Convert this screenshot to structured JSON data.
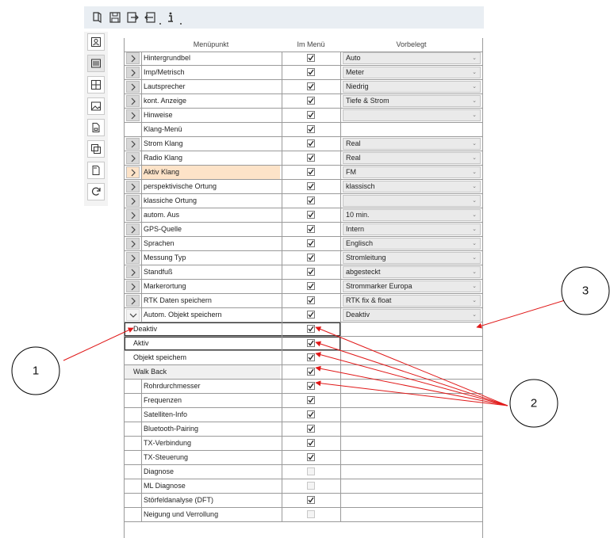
{
  "toolbar": {
    "buttons": [
      {
        "id": "open",
        "icon": "open-book-icon"
      },
      {
        "id": "save",
        "icon": "save-icon"
      },
      {
        "id": "export",
        "icon": "export-icon"
      },
      {
        "id": "import",
        "icon": "import-icon"
      },
      {
        "id": "info",
        "icon": "info-icon"
      }
    ]
  },
  "sidebar": {
    "buttons": [
      {
        "id": "person",
        "icon": "person-card-icon"
      },
      {
        "id": "list",
        "icon": "list-view-icon"
      },
      {
        "id": "grid",
        "icon": "grid-icon"
      },
      {
        "id": "image",
        "icon": "image-icon"
      },
      {
        "id": "document",
        "icon": "document-icon"
      },
      {
        "id": "copy",
        "icon": "copy-icon"
      },
      {
        "id": "sdcard",
        "icon": "sd-card-icon"
      },
      {
        "id": "refresh",
        "icon": "refresh-icon"
      }
    ]
  },
  "table": {
    "headers": {
      "name": "Menüpunkt",
      "checked": "Im Menü",
      "value": "Vorbelegt"
    },
    "rows": [
      {
        "name": "Hintergrundbel",
        "expander": "collapsed",
        "checked": true,
        "value": "Auto"
      },
      {
        "name": "Imp/Metrisch",
        "expander": "collapsed",
        "checked": true,
        "value": "Meter"
      },
      {
        "name": "Lautsprecher",
        "expander": "collapsed",
        "checked": true,
        "value": "Niedrig"
      },
      {
        "name": "kont. Anzeige",
        "expander": "collapsed",
        "checked": true,
        "value": "Tiefe & Strom"
      },
      {
        "name": "Hinweise",
        "expander": "collapsed",
        "checked": true,
        "value": ""
      },
      {
        "name": "Klang-Menü",
        "expander": "none",
        "checked": true,
        "value": null
      },
      {
        "name": "Strom Klang",
        "expander": "collapsed",
        "checked": true,
        "value": "Real"
      },
      {
        "name": "Radio Klang",
        "expander": "collapsed",
        "checked": true,
        "value": "Real"
      },
      {
        "name": "Aktiv Klang",
        "expander": "collapsed",
        "checked": true,
        "value": "FM",
        "highlighted": true
      },
      {
        "name": "perspektivische Ortung",
        "expander": "collapsed",
        "checked": true,
        "value": "klassisch"
      },
      {
        "name": "klassiche Ortung",
        "expander": "collapsed",
        "checked": true,
        "value": ""
      },
      {
        "name": "autom. Aus",
        "expander": "collapsed",
        "checked": true,
        "value": "10 min."
      },
      {
        "name": "GPS-Quelle",
        "expander": "collapsed",
        "checked": true,
        "value": "Intern"
      },
      {
        "name": "Sprachen",
        "expander": "collapsed",
        "checked": true,
        "value": "Englisch"
      },
      {
        "name": "Messung Typ",
        "expander": "collapsed",
        "checked": true,
        "value": "Stromleitung"
      },
      {
        "name": "Standfuß",
        "expander": "collapsed",
        "checked": true,
        "value": "abgesteckt"
      },
      {
        "name": "Markerortung",
        "expander": "collapsed",
        "checked": true,
        "value": "Strommarker Europa"
      },
      {
        "name": "RTK Daten speichern",
        "expander": "collapsed",
        "checked": true,
        "value": "RTK fix & float"
      },
      {
        "name": "Autom. Objekt speichern",
        "expander": "expanded",
        "checked": true,
        "value": "Deaktiv"
      },
      {
        "name": "Deaktiv",
        "expander": "sub",
        "checked": true,
        "value": null,
        "boxed": true
      },
      {
        "name": "Aktiv",
        "expander": "sub",
        "checked": true,
        "value": null,
        "boxed": true
      },
      {
        "name": "Objekt speichem",
        "expander": "sub",
        "checked": true,
        "value": null
      },
      {
        "name": "Walk Back",
        "expander": "sub",
        "checked": true,
        "value": null,
        "grey": true
      },
      {
        "name": "Rohrdurchmesser",
        "expander": "none",
        "checked": true,
        "value": null
      },
      {
        "name": "Frequenzen",
        "expander": "none",
        "checked": true,
        "value": null
      },
      {
        "name": "Satelliten-Info",
        "expander": "none",
        "checked": true,
        "value": null
      },
      {
        "name": "Bluetooth-Pairing",
        "expander": "none",
        "checked": true,
        "value": null
      },
      {
        "name": "TX-Verbindung",
        "expander": "none",
        "checked": true,
        "value": null
      },
      {
        "name": "TX-Steuerung",
        "expander": "none",
        "checked": true,
        "value": null
      },
      {
        "name": "Diagnose",
        "expander": "none",
        "checked": false,
        "disabled": true,
        "value": null
      },
      {
        "name": "ML Diagnose",
        "expander": "none",
        "checked": false,
        "disabled": true,
        "value": null
      },
      {
        "name": "Störfeldanalyse (DFT)",
        "expander": "none",
        "checked": true,
        "value": null
      },
      {
        "name": "Neigung und Verrollung",
        "expander": "none",
        "checked": false,
        "disabled": true,
        "value": null
      }
    ]
  },
  "callouts": [
    {
      "number": "1",
      "target": "expander-autom-objekt"
    },
    {
      "number": "2",
      "target": "submenu-checkboxes"
    },
    {
      "number": "3",
      "target": "dropdown-deaktiv"
    }
  ],
  "colors": {
    "highlight": "#fde3c8",
    "arrow": "#e01818",
    "toolbar_bg": "#e9eef3"
  }
}
